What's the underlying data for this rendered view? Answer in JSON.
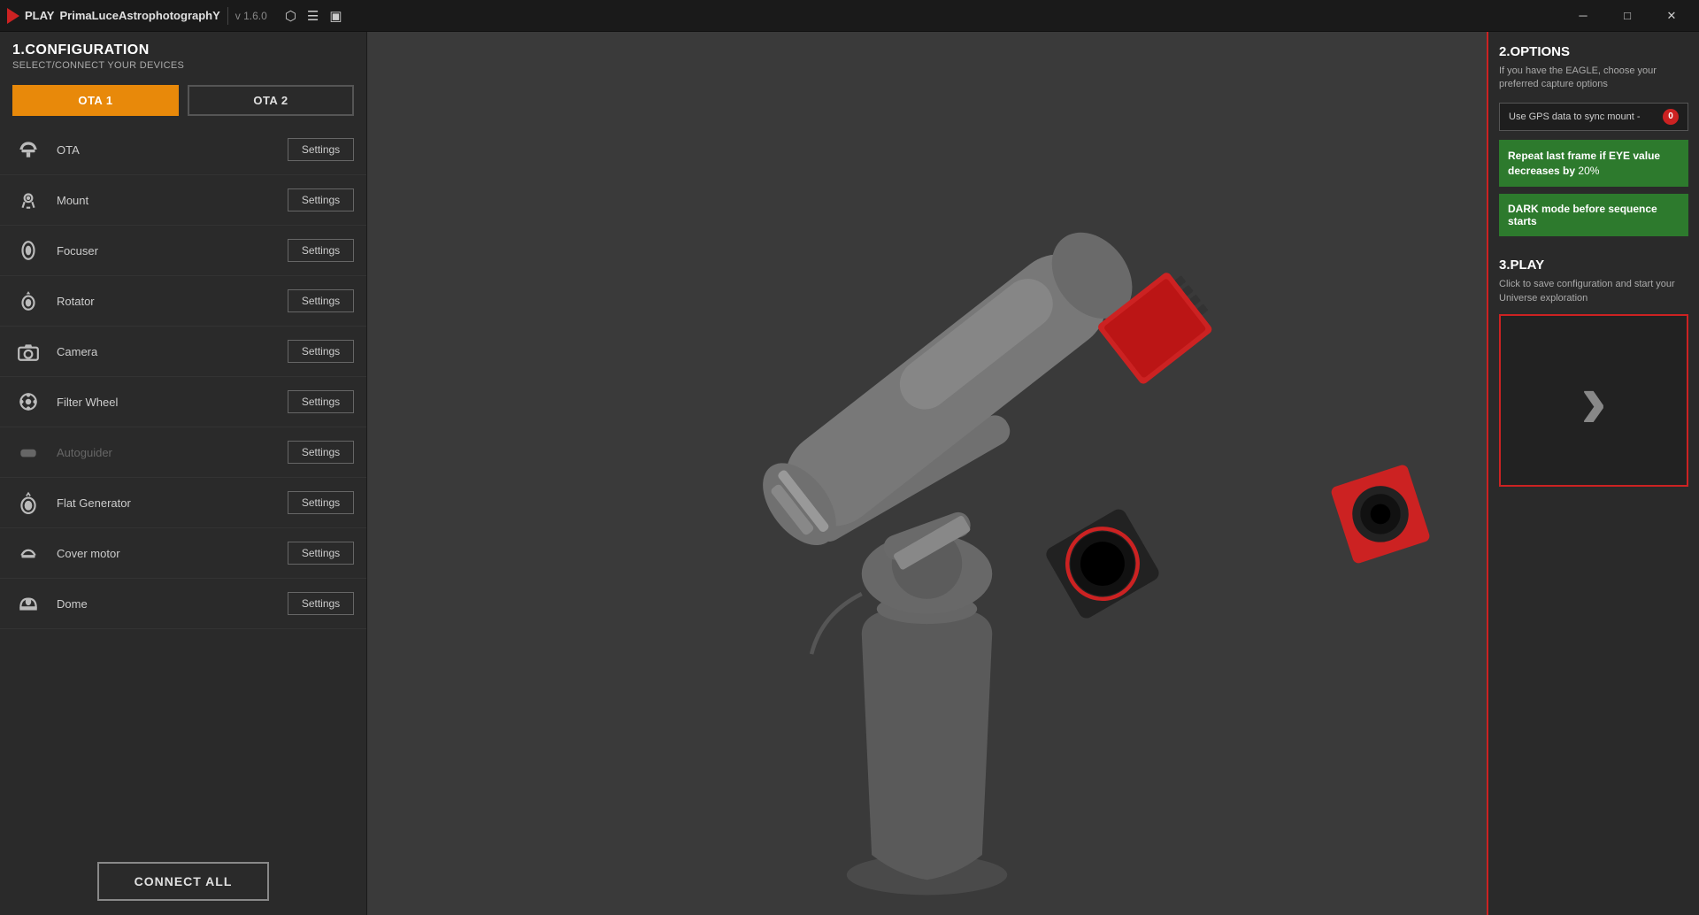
{
  "titlebar": {
    "app_name": "PrimaLuceAstrophotographY",
    "prefix": "PLAY",
    "version": "v 1.6.0",
    "icons": [
      "cursor",
      "sliders",
      "save"
    ]
  },
  "left_panel": {
    "section_title": "1.CONFIGURATION",
    "section_subtitle": "SELECT/CONNECT YOUR DEVICES",
    "ota_tabs": [
      {
        "label": "OTA 1",
        "active": true
      },
      {
        "label": "OTA 2",
        "active": false
      }
    ],
    "devices": [
      {
        "name": "OTA",
        "icon": "ota",
        "dimmed": false
      },
      {
        "name": "Mount",
        "icon": "mount",
        "dimmed": false
      },
      {
        "name": "Focuser",
        "icon": "focuser",
        "dimmed": false
      },
      {
        "name": "Rotator",
        "icon": "rotator",
        "dimmed": false
      },
      {
        "name": "Camera",
        "icon": "camera",
        "dimmed": false
      },
      {
        "name": "Filter Wheel",
        "icon": "filterwheel",
        "dimmed": false
      },
      {
        "name": "Autoguider",
        "icon": "autoguider",
        "dimmed": true
      },
      {
        "name": "Flat Generator",
        "icon": "flatgen",
        "dimmed": false
      },
      {
        "name": "Cover motor",
        "icon": "covermotor",
        "dimmed": false
      },
      {
        "name": "Dome",
        "icon": "dome",
        "dimmed": false
      }
    ],
    "settings_btn_label": "Settings",
    "connect_all_label": "CONNECT ALL"
  },
  "right_panel": {
    "options_title": "2.OPTIONS",
    "options_desc": "If you have the EAGLE, choose your preferred capture options",
    "gps_label": "Use GPS data to sync mount -",
    "repeat_frame_btn": "Repeat last frame if EYE value decreases by 20%",
    "dark_mode_btn": "DARK mode before sequence starts",
    "play_title": "3.PLAY",
    "play_desc": "Click to save configuration and start your Universe exploration"
  }
}
